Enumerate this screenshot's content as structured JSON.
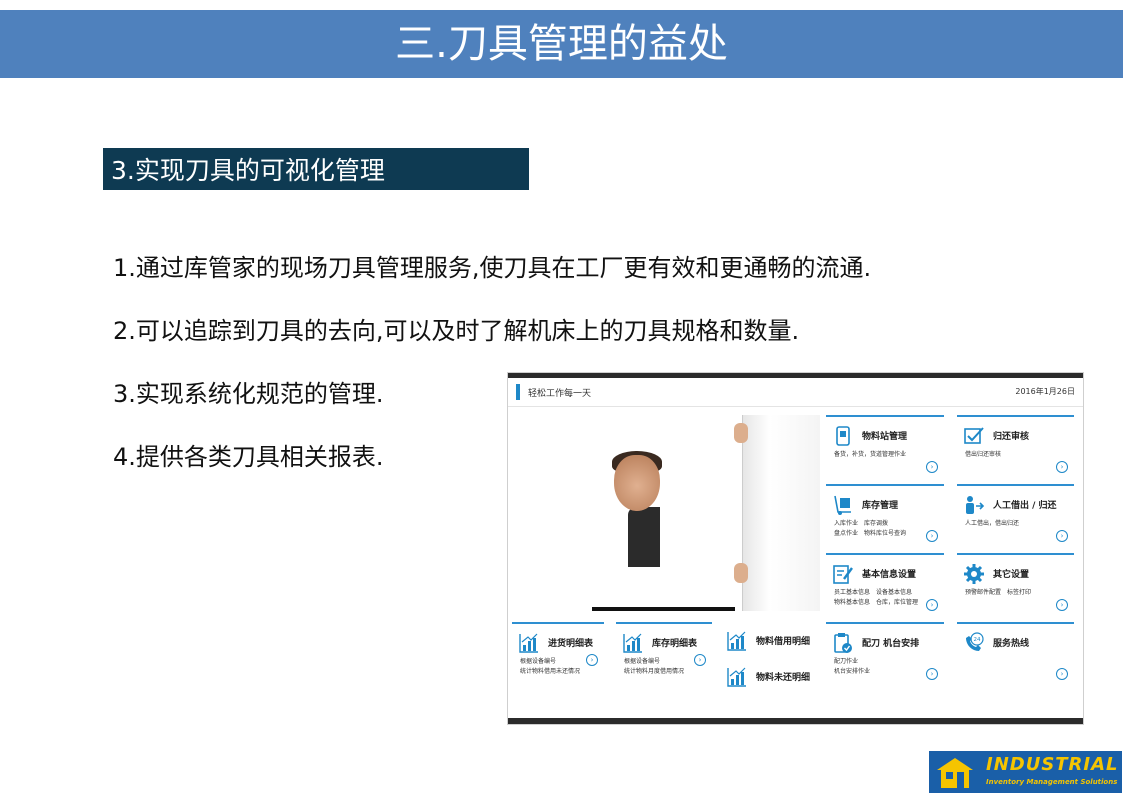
{
  "header": {
    "title": "三.刀具管理的益处"
  },
  "section": {
    "label": "3.实现刀具的可视化管理"
  },
  "bullets": [
    "1.通过库管家的现场刀具管理服务,使刀具在工厂更有效和更通畅的流通.",
    "2.可以追踪到刀具的去向,可以及时了解机床上的刀具规格和数量.",
    "3.实现系统化规范的管理.",
    "4.提供各类刀具相关报表."
  ],
  "app": {
    "greeting": "轻松工作每一天",
    "date": "2016年1月26日",
    "tiles": {
      "material_station": {
        "title": "物料站管理",
        "desc": [
          "备货，补货，货道管理作业"
        ]
      },
      "return_review": {
        "title": "归还审核",
        "desc": [
          "借出归还审核"
        ]
      },
      "inventory": {
        "title": "库存管理",
        "desc": [
          "入库作业　库存调拨",
          "盘点作业　物料库位号查询"
        ]
      },
      "manual_lend": {
        "title": "人工借出 / 归还",
        "desc": [
          "人工借出，借出归还"
        ]
      },
      "basic_info": {
        "title": "基本信息设置",
        "desc": [
          "员工基本信息　设备基本信息",
          "物料基本信息　仓库，库位管理"
        ]
      },
      "other_settings": {
        "title": "其它设置",
        "desc": [
          "预警邮件配置　标签打印"
        ]
      },
      "inbound_detail": {
        "title": "进货明细表",
        "desc": [
          "根据设备编号",
          "统计物料借用未还情况"
        ]
      },
      "stock_detail": {
        "title": "库存明细表",
        "desc": [
          "根据设备编号",
          "统计物料月度借用情况"
        ]
      },
      "borrow_detail": {
        "title": "物料借用明细"
      },
      "unreturned_detail": {
        "title": "物料未还明细"
      },
      "tool_assign": {
        "title": "配刀 机台安排",
        "desc": [
          "配刀作业",
          "机台安排作业"
        ]
      },
      "hotline": {
        "title": "服务热线"
      }
    }
  },
  "logo": {
    "main": "INDUSTRIAL",
    "sub": "Inventory Management Solutions"
  },
  "colors": {
    "title_bar": "#4f81bd",
    "section_bg": "#0e3a52",
    "accent": "#2e8fd1",
    "logo_bg": "#1a5fa8",
    "logo_text": "#f5c400"
  }
}
